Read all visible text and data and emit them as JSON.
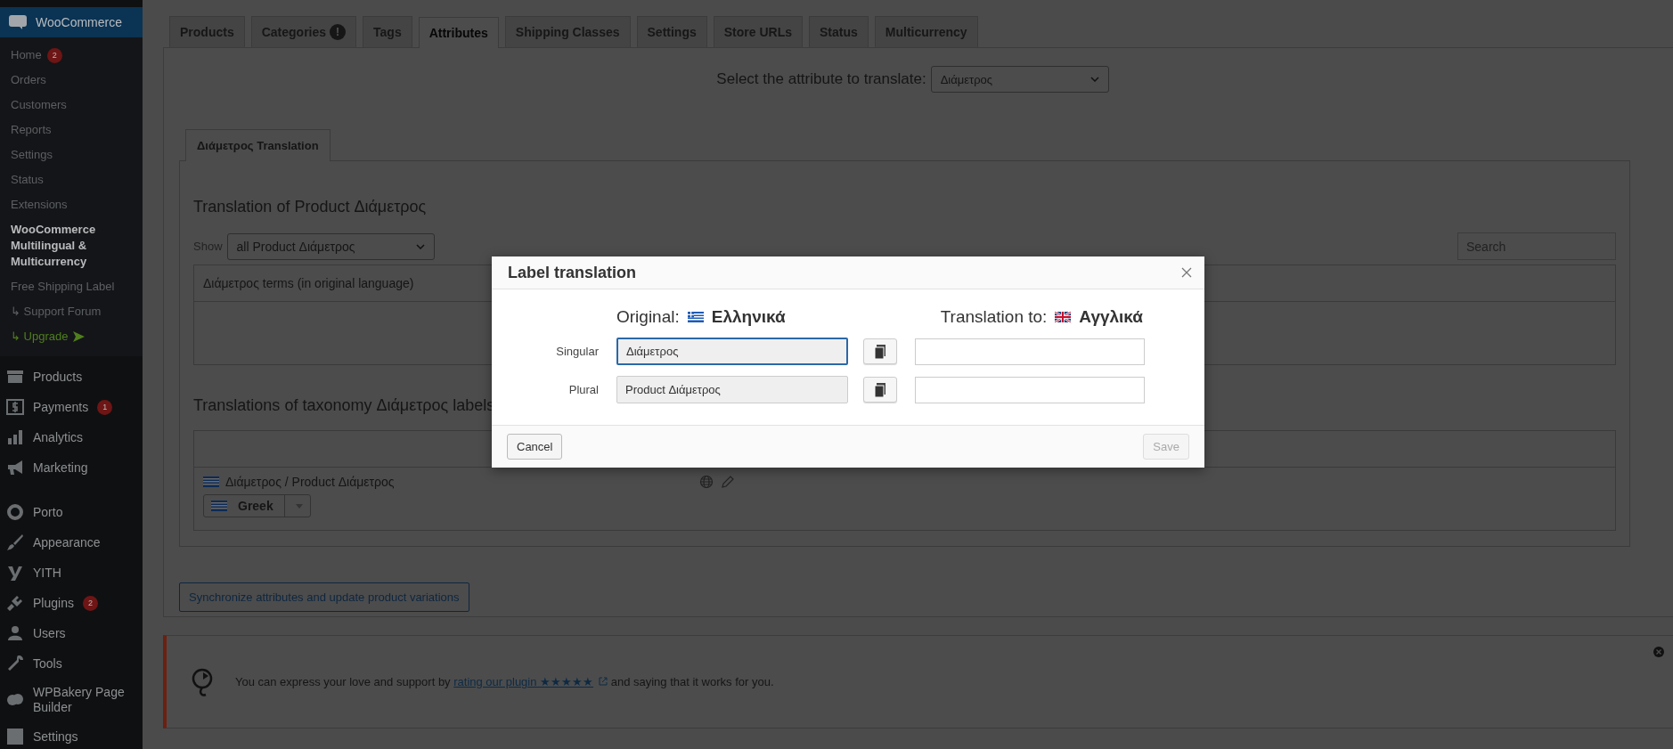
{
  "sidebar": {
    "header": {
      "label": "WooCommerce",
      "selected": true
    },
    "submenu": [
      {
        "label": "Home",
        "count": "2",
        "kind": "plain",
        "selected": false
      },
      {
        "label": "Orders",
        "kind": "plain",
        "selected": false
      },
      {
        "label": "Customers",
        "kind": "plain",
        "selected": false
      },
      {
        "label": "Reports",
        "kind": "plain",
        "selected": false
      },
      {
        "label": "Settings",
        "kind": "plain",
        "selected": false
      },
      {
        "label": "Status",
        "kind": "plain",
        "selected": false
      },
      {
        "label": "Extensions",
        "kind": "plain",
        "selected": false
      },
      {
        "label": "WooCommerce Multilingual & Multicurrency",
        "kind": "plain",
        "selected": true
      },
      {
        "label": "Free Shipping Label",
        "kind": "plain",
        "selected": false
      },
      {
        "label": "↳ Support Forum",
        "kind": "plain",
        "selected": false
      },
      {
        "label": "↳ Upgrade",
        "kind": "highlight",
        "selected": false
      }
    ],
    "menu_groups": [
      [
        {
          "label": "Products"
        },
        {
          "label": "Payments",
          "count": "1"
        },
        {
          "label": "Analytics"
        },
        {
          "label": "Marketing"
        }
      ],
      [
        {
          "label": "Porto"
        },
        {
          "label": "Appearance"
        },
        {
          "label": "YITH"
        },
        {
          "label": "Plugins",
          "count": "2"
        },
        {
          "label": "Users"
        },
        {
          "label": "Tools"
        },
        {
          "label": "WPBakery Page Builder"
        },
        {
          "label": "Settings"
        }
      ]
    ]
  },
  "tabs": [
    {
      "label": "Products",
      "selected": false
    },
    {
      "label": "Categories",
      "badge": "!",
      "selected": false
    },
    {
      "label": "Tags",
      "selected": false
    },
    {
      "label": "Attributes",
      "selected": true
    },
    {
      "label": "Shipping Classes",
      "selected": false
    },
    {
      "label": "Settings",
      "selected": false
    },
    {
      "label": "Store URLs",
      "selected": false
    },
    {
      "label": "Status",
      "selected": false
    },
    {
      "label": "Multicurrency",
      "selected": false
    }
  ],
  "attribute_select": {
    "label": "Select the attribute to translate:",
    "value": "Διάμετρος"
  },
  "subtabs": [
    {
      "label": "Διάμετρος Translation",
      "selected": true
    }
  ],
  "terms_section": {
    "heading": "Translation of Product Διάμετρος",
    "show_label": "Show",
    "show_value": "all Product Διάμετρος",
    "search": {
      "placeholder": "Search"
    },
    "table": {
      "columns": [
        "Διάμετρος terms (in original language)"
      ]
    }
  },
  "labels_section": {
    "heading": "Translations of taxonomy Διάμετρος labels",
    "row": {
      "label": "Διάμετρος / Product Διάμετρος",
      "language": "Greek"
    }
  },
  "sync_button": "Synchronize attributes and update product variations",
  "notice": {
    "before": "You can express your love and support by",
    "link": "rating our plugin ★★★★★",
    "after": "and saying that it works for you."
  },
  "dialog": {
    "title": "Label translation",
    "original_label": "Original:",
    "original_language": "Ελληνικά",
    "translation_label": "Translation to:",
    "translation_language": "Αγγλικά",
    "rows": [
      {
        "label": "Singular",
        "original": "Διάμετρος",
        "focused": true
      },
      {
        "label": "Plural",
        "original": "Product Διάμετρος",
        "focused": false
      }
    ],
    "cancel": "Cancel",
    "save": {
      "label": "Save",
      "disabled": true
    }
  }
}
